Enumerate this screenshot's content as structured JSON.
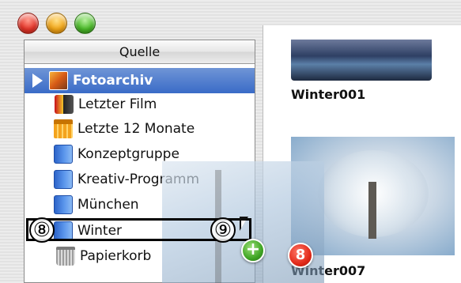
{
  "sidebar": {
    "header": "Quelle",
    "items": [
      {
        "label": "Fotoarchiv",
        "icon": "photo-library-icon"
      },
      {
        "label": "Letzter Film",
        "icon": "film-roll-icon"
      },
      {
        "label": "Letzte 12 Monate",
        "icon": "calendar-icon"
      },
      {
        "label": "Konzeptgruppe",
        "icon": "album-icon"
      },
      {
        "label": "Kreativ-Programm",
        "icon": "album-icon"
      },
      {
        "label": "München",
        "icon": "album-icon"
      },
      {
        "label": "Winter",
        "icon": "album-icon"
      },
      {
        "label": "Papierkorb",
        "icon": "trash-icon"
      }
    ]
  },
  "content": {
    "thumbnails": [
      {
        "label": "Winter001"
      },
      {
        "label": "Winter007"
      }
    ]
  },
  "drag": {
    "count": "8",
    "add_symbol": "+"
  },
  "annotations": {
    "drop_target_marker": "⑧",
    "cursor_marker": "⑨"
  },
  "colors": {
    "selection": "#3a6bc7",
    "add_badge": "#3fa524",
    "count_badge": "#e22a1a"
  }
}
